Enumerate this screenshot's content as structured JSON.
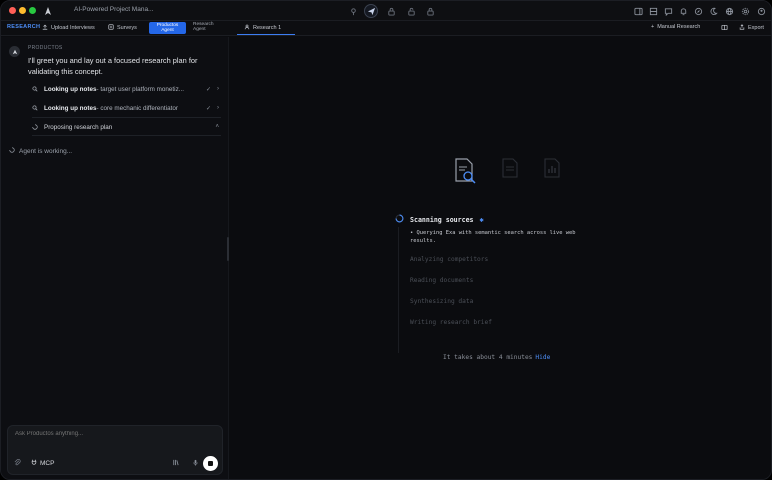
{
  "window": {
    "title": "AI-Powered Project Mana..."
  },
  "tabs": {
    "research": "RESEARCH",
    "upload_interviews": "Upload Interviews",
    "surveys": "Surveys",
    "productos_agent_line1": "Productos",
    "productos_agent_line2": "Agent",
    "research_agent_line1": "Research",
    "research_agent_line2": "Agent",
    "research_1": "Research 1",
    "manual_research": "Manual Research",
    "export": "Export"
  },
  "chat": {
    "sender": "PRODUCTOS",
    "message": "I'll greet you and lay out a focused research plan for validating this concept.",
    "tool_calls": [
      {
        "action": "Looking up notes",
        "detail": "- target user platform monetiz...",
        "status": "done"
      },
      {
        "action": "Looking up notes",
        "detail": "- core mechanic differentiator",
        "status": "done"
      },
      {
        "action": "Proposing research plan",
        "detail": "",
        "status": "running"
      }
    ],
    "working_text": "Agent is working...",
    "composer_placeholder": "Ask Productos anything...",
    "mcp_label": "MCP"
  },
  "progress": {
    "steps": [
      {
        "label": "Scanning sources",
        "state": "active"
      },
      {
        "label": "Analyzing competitors",
        "state": "pending"
      },
      {
        "label": "Reading documents",
        "state": "pending"
      },
      {
        "label": "Synthesizing data",
        "state": "pending"
      },
      {
        "label": "Writing research brief",
        "state": "pending"
      }
    ],
    "active_detail": "Querying Exa with semantic search across live web results.",
    "eta": "It takes about 4 minutes",
    "hide_label": "Hide"
  },
  "colors": {
    "accent": "#2467e8",
    "link": "#4d8ef7",
    "background": "#0b0c0f"
  }
}
